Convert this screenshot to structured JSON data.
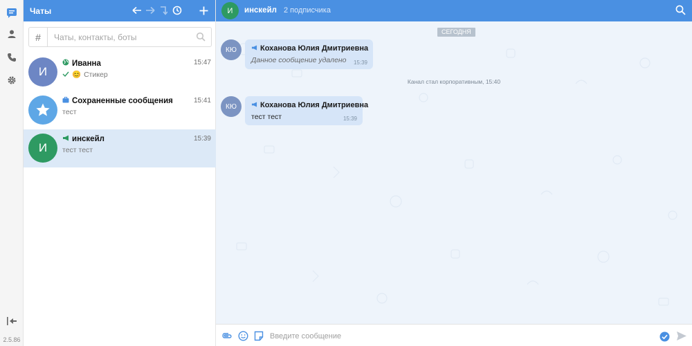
{
  "colors": {
    "accent": "#4a90e2",
    "active_item": "#dce9f7",
    "chat_bg": "#eef4fb",
    "bubble": "#d6e5f8"
  },
  "rail": {
    "icons": [
      "chats-icon",
      "contacts-icon",
      "phone-icon",
      "gear-icon"
    ],
    "collapse_icon": "collapse-left-icon",
    "version": "2.5.86"
  },
  "list": {
    "title": "Чаты",
    "header_icons": [
      "arrow-left-icon",
      "arrow-right-icon",
      "return-icon",
      "history-icon",
      "plus-icon"
    ],
    "search": {
      "hash": "#",
      "placeholder": "Чаты, контакты, боты"
    },
    "chats": [
      {
        "avatar_letter": "И",
        "avatar_color": "#6d86c4",
        "type_icon": "globe-icon",
        "name": "Иванна",
        "time": "15:47",
        "preview": "Стикер",
        "preview_prefix_icon": "check-icon",
        "preview_emoji": "😊"
      },
      {
        "avatar_letter": "★",
        "avatar_color": "#5ea7e6",
        "type_icon": "briefcase-icon",
        "name": "Сохраненные сообщения",
        "time": "15:41",
        "preview": "тест"
      },
      {
        "avatar_letter": "И",
        "avatar_color": "#2e9a62",
        "type_icon": "megaphone-icon",
        "name": "инскейл",
        "time": "15:39",
        "preview": "тест тест",
        "active": true
      }
    ]
  },
  "chat": {
    "avatar_letter": "И",
    "name": "инскейл",
    "subscribers": "2 подписчика",
    "date_divider": "СЕГОДНЯ",
    "messages": [
      {
        "avatar": "КЮ",
        "sender": "Коханова Юлия Дмитриевна",
        "text": "Данное сообщение удалено",
        "time": "15:39",
        "deleted": true
      },
      {
        "avatar": "КЮ",
        "sender": "Коханова Юлия Дмитриевна",
        "text": "тест тест",
        "time": "15:39",
        "deleted": false
      }
    ],
    "system_message": "Канал стал корпоративным, 15:40"
  },
  "composer": {
    "placeholder": "Введите сообщение",
    "icons": [
      "attach-icon",
      "emoji-icon",
      "sticker-icon",
      "send-icon",
      "status-check-icon"
    ]
  }
}
